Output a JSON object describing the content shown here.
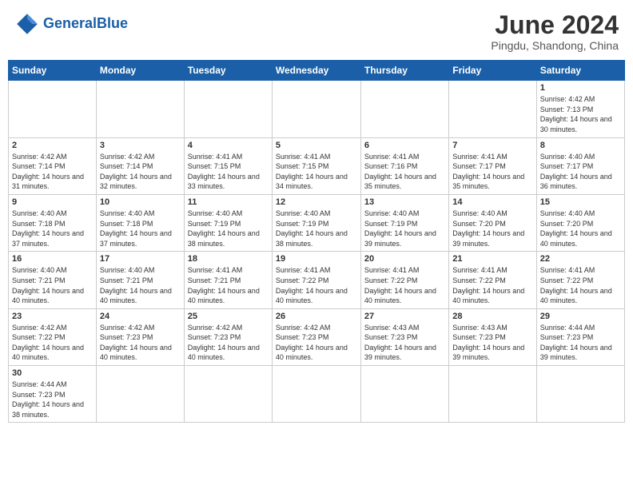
{
  "header": {
    "logo_general": "General",
    "logo_blue": "Blue",
    "month_title": "June 2024",
    "subtitle": "Pingdu, Shandong, China"
  },
  "weekdays": [
    "Sunday",
    "Monday",
    "Tuesday",
    "Wednesday",
    "Thursday",
    "Friday",
    "Saturday"
  ],
  "weeks": [
    [
      {
        "day": "",
        "info": ""
      },
      {
        "day": "",
        "info": ""
      },
      {
        "day": "",
        "info": ""
      },
      {
        "day": "",
        "info": ""
      },
      {
        "day": "",
        "info": ""
      },
      {
        "day": "",
        "info": ""
      },
      {
        "day": "1",
        "info": "Sunrise: 4:42 AM\nSunset: 7:13 PM\nDaylight: 14 hours and 30 minutes."
      }
    ],
    [
      {
        "day": "2",
        "info": "Sunrise: 4:42 AM\nSunset: 7:14 PM\nDaylight: 14 hours and 31 minutes."
      },
      {
        "day": "3",
        "info": "Sunrise: 4:42 AM\nSunset: 7:14 PM\nDaylight: 14 hours and 32 minutes."
      },
      {
        "day": "4",
        "info": "Sunrise: 4:41 AM\nSunset: 7:15 PM\nDaylight: 14 hours and 33 minutes."
      },
      {
        "day": "5",
        "info": "Sunrise: 4:41 AM\nSunset: 7:15 PM\nDaylight: 14 hours and 34 minutes."
      },
      {
        "day": "6",
        "info": "Sunrise: 4:41 AM\nSunset: 7:16 PM\nDaylight: 14 hours and 35 minutes."
      },
      {
        "day": "7",
        "info": "Sunrise: 4:41 AM\nSunset: 7:17 PM\nDaylight: 14 hours and 35 minutes."
      },
      {
        "day": "8",
        "info": "Sunrise: 4:40 AM\nSunset: 7:17 PM\nDaylight: 14 hours and 36 minutes."
      }
    ],
    [
      {
        "day": "9",
        "info": "Sunrise: 4:40 AM\nSunset: 7:18 PM\nDaylight: 14 hours and 37 minutes."
      },
      {
        "day": "10",
        "info": "Sunrise: 4:40 AM\nSunset: 7:18 PM\nDaylight: 14 hours and 37 minutes."
      },
      {
        "day": "11",
        "info": "Sunrise: 4:40 AM\nSunset: 7:19 PM\nDaylight: 14 hours and 38 minutes."
      },
      {
        "day": "12",
        "info": "Sunrise: 4:40 AM\nSunset: 7:19 PM\nDaylight: 14 hours and 38 minutes."
      },
      {
        "day": "13",
        "info": "Sunrise: 4:40 AM\nSunset: 7:19 PM\nDaylight: 14 hours and 39 minutes."
      },
      {
        "day": "14",
        "info": "Sunrise: 4:40 AM\nSunset: 7:20 PM\nDaylight: 14 hours and 39 minutes."
      },
      {
        "day": "15",
        "info": "Sunrise: 4:40 AM\nSunset: 7:20 PM\nDaylight: 14 hours and 40 minutes."
      }
    ],
    [
      {
        "day": "16",
        "info": "Sunrise: 4:40 AM\nSunset: 7:21 PM\nDaylight: 14 hours and 40 minutes."
      },
      {
        "day": "17",
        "info": "Sunrise: 4:40 AM\nSunset: 7:21 PM\nDaylight: 14 hours and 40 minutes."
      },
      {
        "day": "18",
        "info": "Sunrise: 4:41 AM\nSunset: 7:21 PM\nDaylight: 14 hours and 40 minutes."
      },
      {
        "day": "19",
        "info": "Sunrise: 4:41 AM\nSunset: 7:22 PM\nDaylight: 14 hours and 40 minutes."
      },
      {
        "day": "20",
        "info": "Sunrise: 4:41 AM\nSunset: 7:22 PM\nDaylight: 14 hours and 40 minutes."
      },
      {
        "day": "21",
        "info": "Sunrise: 4:41 AM\nSunset: 7:22 PM\nDaylight: 14 hours and 40 minutes."
      },
      {
        "day": "22",
        "info": "Sunrise: 4:41 AM\nSunset: 7:22 PM\nDaylight: 14 hours and 40 minutes."
      }
    ],
    [
      {
        "day": "23",
        "info": "Sunrise: 4:42 AM\nSunset: 7:22 PM\nDaylight: 14 hours and 40 minutes."
      },
      {
        "day": "24",
        "info": "Sunrise: 4:42 AM\nSunset: 7:23 PM\nDaylight: 14 hours and 40 minutes."
      },
      {
        "day": "25",
        "info": "Sunrise: 4:42 AM\nSunset: 7:23 PM\nDaylight: 14 hours and 40 minutes."
      },
      {
        "day": "26",
        "info": "Sunrise: 4:42 AM\nSunset: 7:23 PM\nDaylight: 14 hours and 40 minutes."
      },
      {
        "day": "27",
        "info": "Sunrise: 4:43 AM\nSunset: 7:23 PM\nDaylight: 14 hours and 39 minutes."
      },
      {
        "day": "28",
        "info": "Sunrise: 4:43 AM\nSunset: 7:23 PM\nDaylight: 14 hours and 39 minutes."
      },
      {
        "day": "29",
        "info": "Sunrise: 4:44 AM\nSunset: 7:23 PM\nDaylight: 14 hours and 39 minutes."
      }
    ],
    [
      {
        "day": "30",
        "info": "Sunrise: 4:44 AM\nSunset: 7:23 PM\nDaylight: 14 hours and 38 minutes."
      },
      {
        "day": "",
        "info": ""
      },
      {
        "day": "",
        "info": ""
      },
      {
        "day": "",
        "info": ""
      },
      {
        "day": "",
        "info": ""
      },
      {
        "day": "",
        "info": ""
      },
      {
        "day": "",
        "info": ""
      }
    ]
  ]
}
